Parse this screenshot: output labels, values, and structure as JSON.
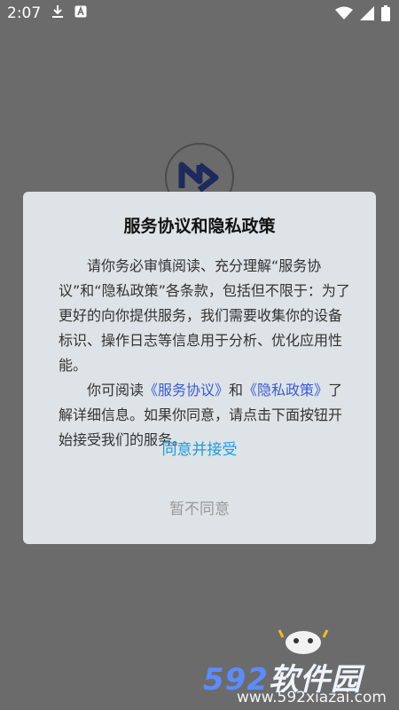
{
  "status": {
    "time": "2:07"
  },
  "dialog": {
    "title": "服务协议和隐私政策",
    "para1": "请你务必审慎阅读、充分理解“服务协议”和“隐私政策”各条款，包括但不限于：为了更好的向你提供服务，我们需要收集你的设备标识、操作日志等信息用于分析、优化应用性能。",
    "para2_prefix": "你可阅读",
    "link_service": "《服务协议》",
    "para2_and": "和",
    "link_privacy": "《隐私政策》",
    "para2_suffix": "了解详细信息。如果你同意，请点击下面按钮开始接受我们的服务。",
    "accept_label": "同意并接受",
    "decline_label": "暂不同意"
  },
  "watermark": {
    "brand_num": "592",
    "brand_text": "软件园",
    "url": "www.592xiazai.com"
  },
  "colors": {
    "background": "#6b6b6b",
    "dialog_bg": "#dde3e6",
    "accept": "#1e9be0",
    "link": "#3b5bd6",
    "decline": "#999999"
  }
}
